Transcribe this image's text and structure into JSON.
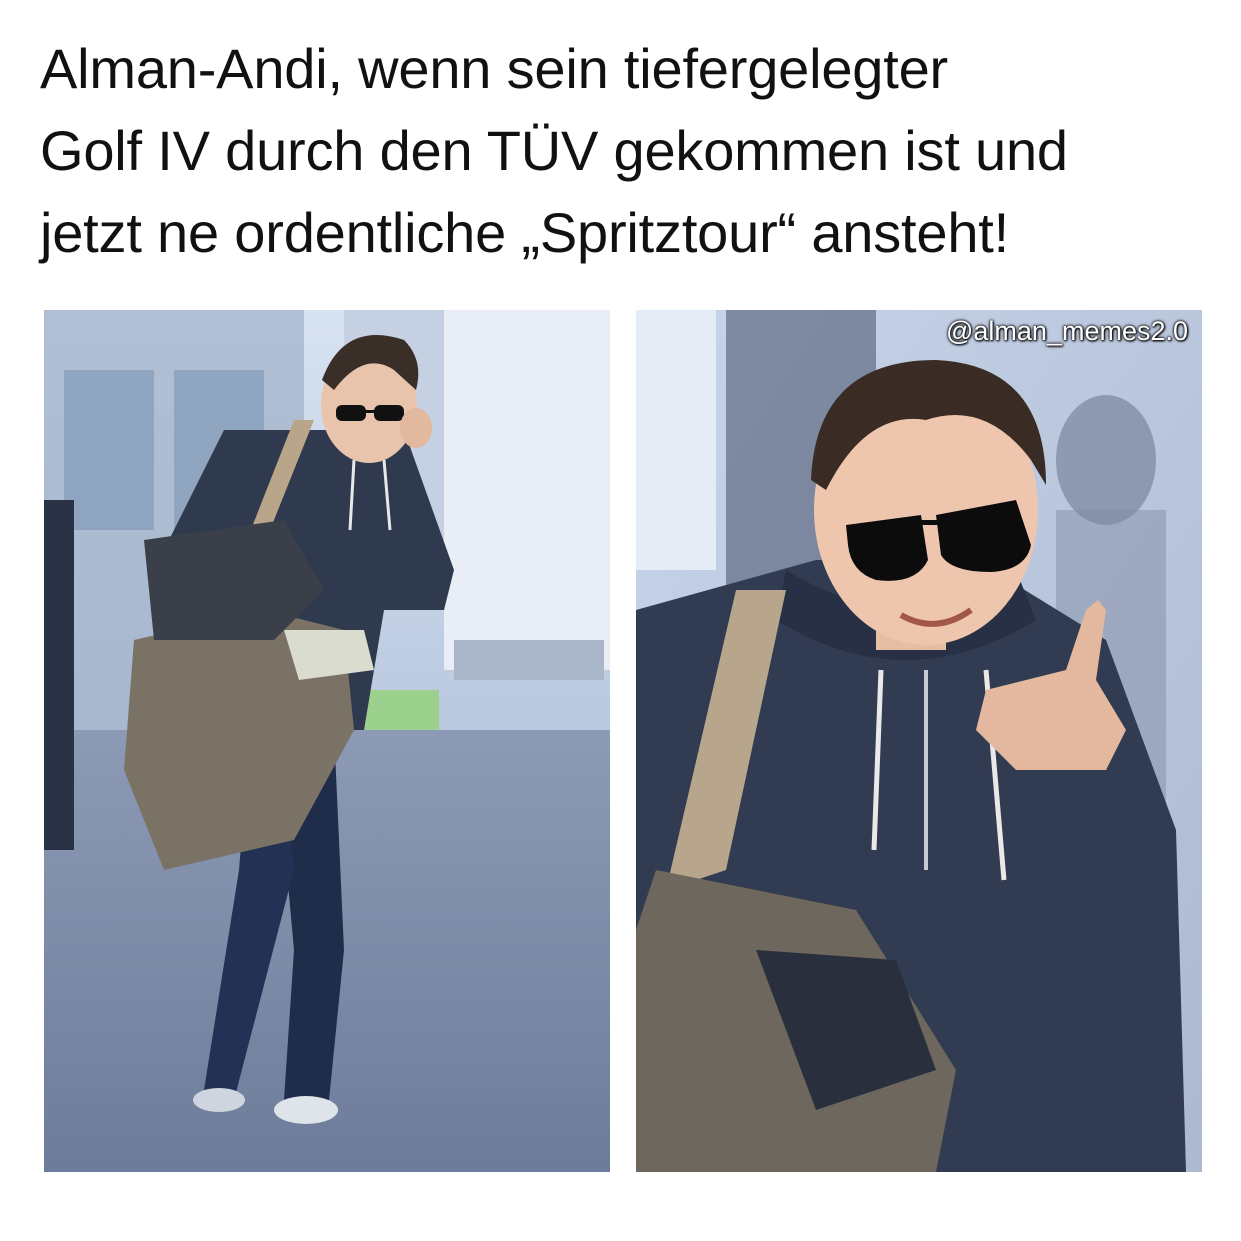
{
  "caption": {
    "line1": "Alman-Andi, wenn sein tiefergelegter",
    "line2": "Golf IV durch den TÜV gekommen ist und",
    "line3": "jetzt ne ordentliche „Spritztour“ ansteht!"
  },
  "watermark": "@alman_memes2.0",
  "colors": {
    "background": "#ffffff",
    "text": "#111111",
    "sky": "#c9d6ea",
    "pavement": "#7f8fac",
    "hoodie": "#2f3a4e",
    "jeans": "#1f2c4a",
    "bag": "#7b7266"
  }
}
